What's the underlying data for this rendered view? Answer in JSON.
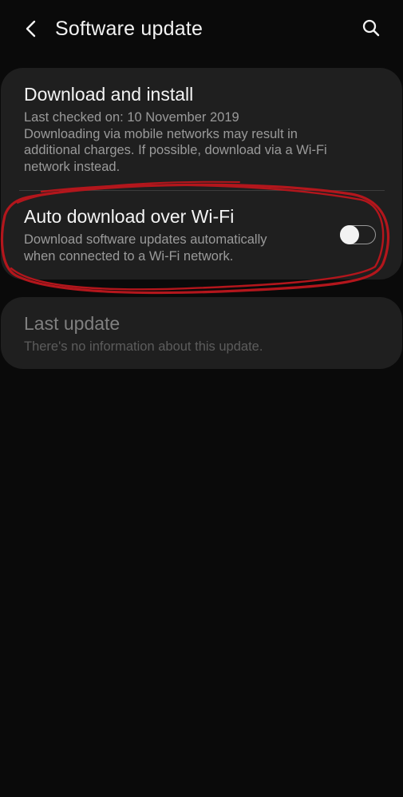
{
  "header": {
    "title": "Software update",
    "back_icon": "back-arrow-icon",
    "search_icon": "search-icon"
  },
  "download_install": {
    "title": "Download and install",
    "desc_lines": [
      "Last checked on: 10 November 2019",
      "Downloading via mobile networks may result in",
      "additional charges. If possible, download via a Wi-Fi",
      "network instead."
    ]
  },
  "auto_download": {
    "title": "Auto download over Wi-Fi",
    "desc_lines": [
      "Download software updates automatically",
      "when connected to a Wi-Fi network."
    ],
    "toggle_on": false
  },
  "last_update": {
    "title": "Last update",
    "desc": "There's no information about this update.",
    "enabled": false
  },
  "colors": {
    "background": "#0a0a0a",
    "card": "#1f1f1f",
    "annotation": "#b3161c"
  }
}
